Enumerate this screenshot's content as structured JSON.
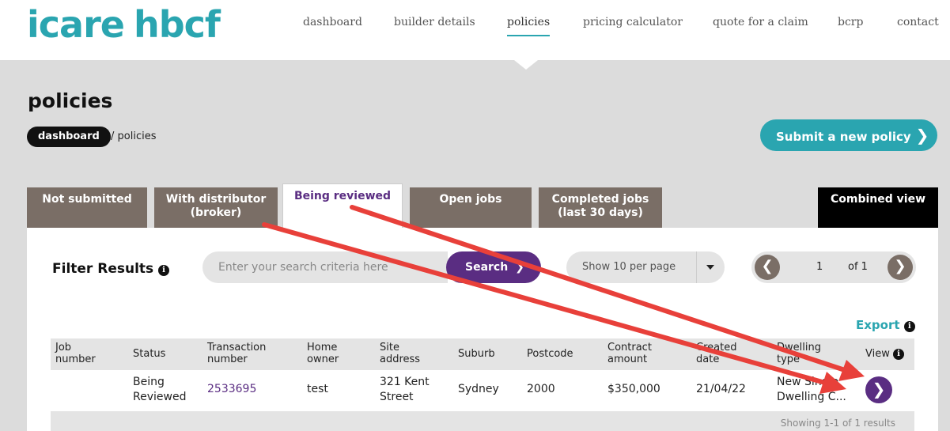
{
  "brand": {
    "part1": "icare",
    "tm": "™",
    "part2": "hbcf"
  },
  "nav": {
    "items": [
      {
        "label": "dashboard"
      },
      {
        "label": "builder details"
      },
      {
        "label": "policies"
      },
      {
        "label": "pricing calculator"
      },
      {
        "label": "quote for a claim"
      },
      {
        "label": "bcrp"
      },
      {
        "label": "contact"
      }
    ],
    "active": "policies"
  },
  "page": {
    "title": "policies",
    "breadcrumb": {
      "home": "dashboard",
      "current": "/ policies"
    },
    "submit_label": "Submit a new policy",
    "submit_chevron": "❯"
  },
  "tabs": [
    {
      "line1": "Not submitted",
      "line2": ""
    },
    {
      "line1": "With distributor",
      "line2": "(broker)"
    },
    {
      "line1": "Being reviewed",
      "line2": ""
    },
    {
      "line1": "Open jobs",
      "line2": ""
    },
    {
      "line1": "Completed jobs",
      "line2": "(last 30 days)"
    },
    {
      "line1": "Combined view",
      "line2": ""
    }
  ],
  "filter": {
    "title": "Filter Results",
    "info_icon": "i",
    "search_placeholder": "Enter your search criteria here",
    "search_label": "Search",
    "search_chevron": "❯",
    "per_page": "Show 10 per page",
    "page_prev": "❮",
    "page_number": "1",
    "page_of": "of 1",
    "page_next": "❯"
  },
  "table": {
    "export_label": "Export",
    "columns": [
      {
        "l1": "Job",
        "l2": "number"
      },
      {
        "l1": "Status",
        "l2": ""
      },
      {
        "l1": "Transaction",
        "l2": "number"
      },
      {
        "l1": "Home",
        "l2": "owner"
      },
      {
        "l1": "Site",
        "l2": "address"
      },
      {
        "l1": "Suburb",
        "l2": ""
      },
      {
        "l1": "Postcode",
        "l2": ""
      },
      {
        "l1": "Contract",
        "l2": "amount"
      },
      {
        "l1": "Created",
        "l2": "date"
      },
      {
        "l1": "Dwelling",
        "l2": "type"
      },
      {
        "l1": "View",
        "l2": ""
      }
    ],
    "row": {
      "job_number": "",
      "status_l1": "Being",
      "status_l2": "Reviewed",
      "transaction_number": "2533695",
      "home_owner": "test",
      "site_l1": "321 Kent",
      "site_l2": "Street",
      "suburb": "Sydney",
      "postcode": "2000",
      "contract_amount": "$350,000",
      "created_date": "21/04/22",
      "dwelling_l1": "New Single",
      "dwelling_l2": "Dwelling C...",
      "view_chevron": "❯"
    },
    "showing": "Showing 1-1 of 1 results"
  },
  "colors": {
    "teal": "#2aa5b0",
    "purple": "#5a2d82",
    "tab_brown": "#7a6e66",
    "arrow_red": "#e8403a"
  }
}
